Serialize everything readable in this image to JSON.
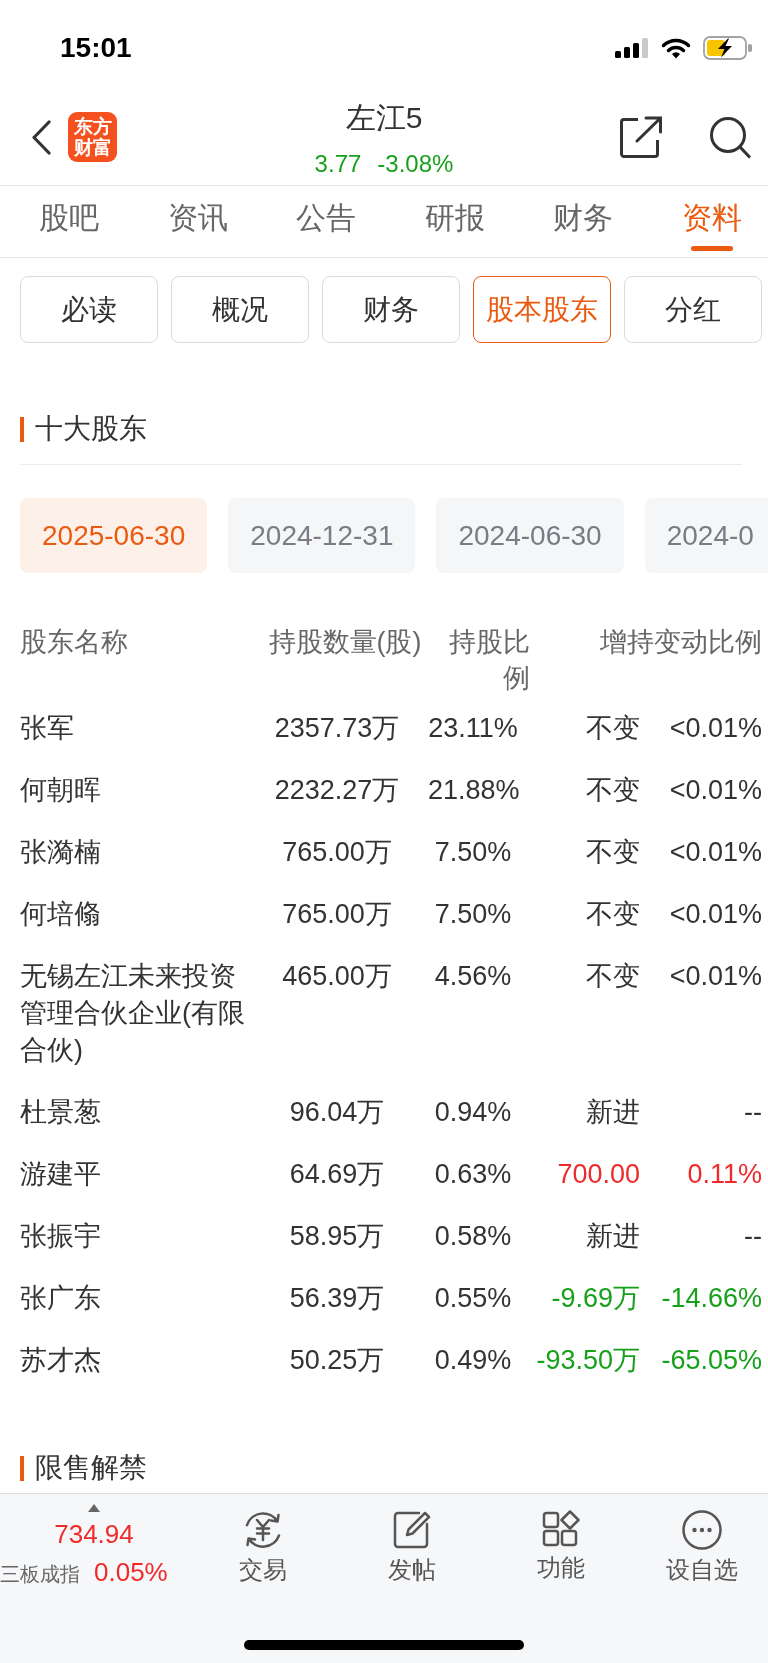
{
  "status_bar": {
    "time": "15:01"
  },
  "header": {
    "logo": "东方财富",
    "title": "左江5",
    "quote": {
      "price": "3.77",
      "change": "-3.08%",
      "color": "#17a11b"
    }
  },
  "tabs": [
    {
      "label": "股吧",
      "selected": false
    },
    {
      "label": "资讯",
      "selected": false
    },
    {
      "label": "公告",
      "selected": false
    },
    {
      "label": "研报",
      "selected": false
    },
    {
      "label": "财务",
      "selected": false
    },
    {
      "label": "资料",
      "selected": true
    }
  ],
  "sub_tabs": [
    {
      "label": "必读",
      "selected": false
    },
    {
      "label": "概况",
      "selected": false
    },
    {
      "label": "财务",
      "selected": false
    },
    {
      "label": "股本股东",
      "selected": true
    },
    {
      "label": "分红",
      "selected": false
    }
  ],
  "shareholders": {
    "title": "十大股东",
    "dates": [
      {
        "label": "2025-06-30",
        "selected": true
      },
      {
        "label": "2024-12-31",
        "selected": false
      },
      {
        "label": "2024-06-30",
        "selected": false
      },
      {
        "label": "2024-0",
        "selected": false
      }
    ],
    "table": {
      "columns": [
        "股东名称",
        "持股数量(股)",
        "持股比例",
        "增持变动比例"
      ],
      "rows": [
        {
          "name": "张军",
          "shares": "2357.73万",
          "ratio": "23.11%",
          "change": "不变",
          "change_ratio": "<0.01%",
          "color": "#333333"
        },
        {
          "name": "何朝晖",
          "shares": "2232.27万",
          "ratio": "21.88%",
          "change": "不变",
          "change_ratio": "<0.01%",
          "color": "#333333"
        },
        {
          "name": "张漪楠",
          "shares": "765.00万",
          "ratio": "7.50%",
          "change": "不变",
          "change_ratio": "<0.01%",
          "color": "#333333"
        },
        {
          "name": "何培翛",
          "shares": "765.00万",
          "ratio": "7.50%",
          "change": "不变",
          "change_ratio": "<0.01%",
          "color": "#333333"
        },
        {
          "name": "无锡左江未来投资管理合伙企业(有限合伙)",
          "shares": "465.00万",
          "ratio": "4.56%",
          "change": "不变",
          "change_ratio": "<0.01%",
          "color": "#333333"
        },
        {
          "name": "杜景葱",
          "shares": "96.04万",
          "ratio": "0.94%",
          "change": "新进",
          "change_ratio": "--",
          "color": "#333333"
        },
        {
          "name": "游建平",
          "shares": "64.69万",
          "ratio": "0.63%",
          "change": "700.00",
          "change_ratio": "0.11%",
          "color": "#ee2a2a"
        },
        {
          "name": "张振宇",
          "shares": "58.95万",
          "ratio": "0.58%",
          "change": "新进",
          "change_ratio": "--",
          "color": "#333333"
        },
        {
          "name": "张广东",
          "shares": "56.39万",
          "ratio": "0.55%",
          "change": "-9.69万",
          "change_ratio": "-14.66%",
          "color": "#17a11b"
        },
        {
          "name": "苏才杰",
          "shares": "50.25万",
          "ratio": "0.49%",
          "change": "-93.50万",
          "change_ratio": "-65.05%",
          "color": "#17a11b"
        }
      ]
    }
  },
  "next_section": {
    "title": "限售解禁"
  },
  "bottom_bar": {
    "index": {
      "value": "734.94",
      "name": "三板成指",
      "change": "0.05%",
      "color": "#ee2a2a"
    },
    "actions": [
      {
        "label": "交易"
      },
      {
        "label": "发帖"
      },
      {
        "label": "功能"
      },
      {
        "label": "设自选"
      }
    ]
  }
}
